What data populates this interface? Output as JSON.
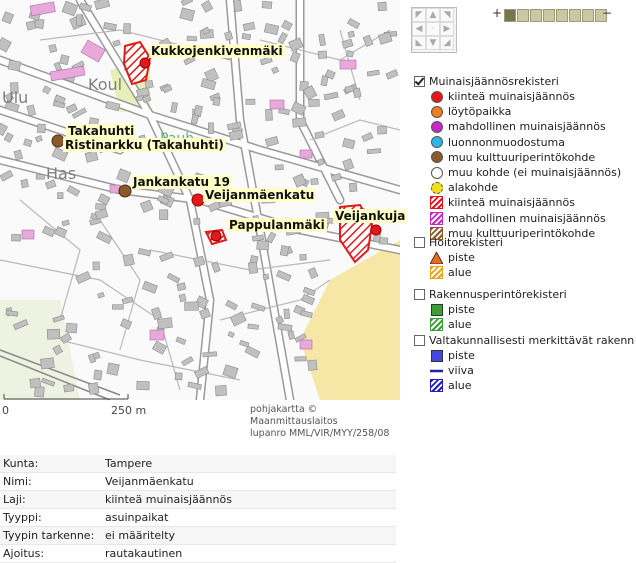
{
  "map": {
    "labels": [
      "Kukkojenkivenmäki",
      "Takahuhti",
      "Ristinarkku (Takahuhti)",
      "Jankankatu 19",
      "Veijanmäenkatu",
      "Pappulanmäki",
      "Veijankuja"
    ],
    "basemap_text": [
      "Koul",
      "Ulu",
      "Has",
      "Pauh"
    ],
    "scale": {
      "zero": "0",
      "label": "250 m"
    },
    "attribution": [
      "pohjakartta © Maanmittauslaitos",
      "lupanro MML/VIR/MYY/258/08"
    ]
  },
  "controls": {
    "zoom_plus": "+",
    "zoom_minus": "−",
    "zoom_level": 1,
    "zoom_steps": 8,
    "pan_icons": [
      "arrow-up-left-icon",
      "arrow-up-icon",
      "arrow-up-right-icon",
      "arrow-left-icon",
      "center-icon",
      "arrow-right-icon",
      "arrow-down-left-icon",
      "arrow-down-icon",
      "arrow-down-right-icon"
    ]
  },
  "legend": {
    "groups": [
      {
        "title": "Muinaisjäännösrekisteri",
        "checked": true,
        "items": [
          {
            "label": "kiinteä muinaisjäännös",
            "symbol": "dot",
            "color": "#e8141c"
          },
          {
            "label": "löytöpaikka",
            "symbol": "dot",
            "color": "#f07d1e"
          },
          {
            "label": "mahdollinen muinaisjäännös",
            "symbol": "dot",
            "color": "#c729c8"
          },
          {
            "label": "luonnonmuodostuma",
            "symbol": "dot",
            "color": "#2cb6e8"
          },
          {
            "label": "muu kulttuuriperintökohde",
            "symbol": "dot",
            "color": "#8a5a2a"
          },
          {
            "label": "muu kohde (ei muinaisjäännös)",
            "symbol": "dot",
            "color": "#ffffff"
          },
          {
            "label": "alakohde",
            "symbol": "dot",
            "color": "#f0e020"
          },
          {
            "label": "kiinteä muinaisjäännös",
            "symbol": "hatch",
            "color": "#e8141c"
          },
          {
            "label": "mahdollinen muinaisjäännös",
            "symbol": "hatch",
            "color": "#c729c8"
          },
          {
            "label": "muu kulttuuriperintökohde",
            "symbol": "hatch",
            "color": "#8a5a2a"
          }
        ]
      },
      {
        "title": "Hoitorekisteri",
        "checked": false,
        "items": [
          {
            "label": "piste",
            "symbol": "triangle",
            "color": "#e86a1c"
          },
          {
            "label": "alue",
            "symbol": "hatch",
            "color": "#e8a21c"
          }
        ]
      },
      {
        "title": "Rakennusperintörekisteri",
        "checked": false,
        "items": [
          {
            "label": "piste",
            "symbol": "square",
            "color": "#3aa036"
          },
          {
            "label": "alue",
            "symbol": "hatch",
            "color": "#3aa036"
          }
        ]
      },
      {
        "title": "Valtakunnallisesti merkittävät rakenn",
        "checked": false,
        "items": [
          {
            "label": "piste",
            "symbol": "square",
            "color": "#4646e0"
          },
          {
            "label": "viiva",
            "symbol": "line",
            "color": "#2020a0"
          },
          {
            "label": "alue",
            "symbol": "hatch",
            "color": "#2020c0"
          }
        ]
      }
    ]
  },
  "info": [
    {
      "key": "Kunta:",
      "value": "Tampere"
    },
    {
      "key": "Nimi:",
      "value": "Veijanmäenkatu"
    },
    {
      "key": "Laji:",
      "value": "kiinteä muinaisjäännös"
    },
    {
      "key": "Tyyppi:",
      "value": "asuinpaikat"
    },
    {
      "key": "Tyypin tarkenne:",
      "value": "ei määritelty"
    },
    {
      "key": "Ajoitus:",
      "value": "rautakautinen"
    }
  ]
}
